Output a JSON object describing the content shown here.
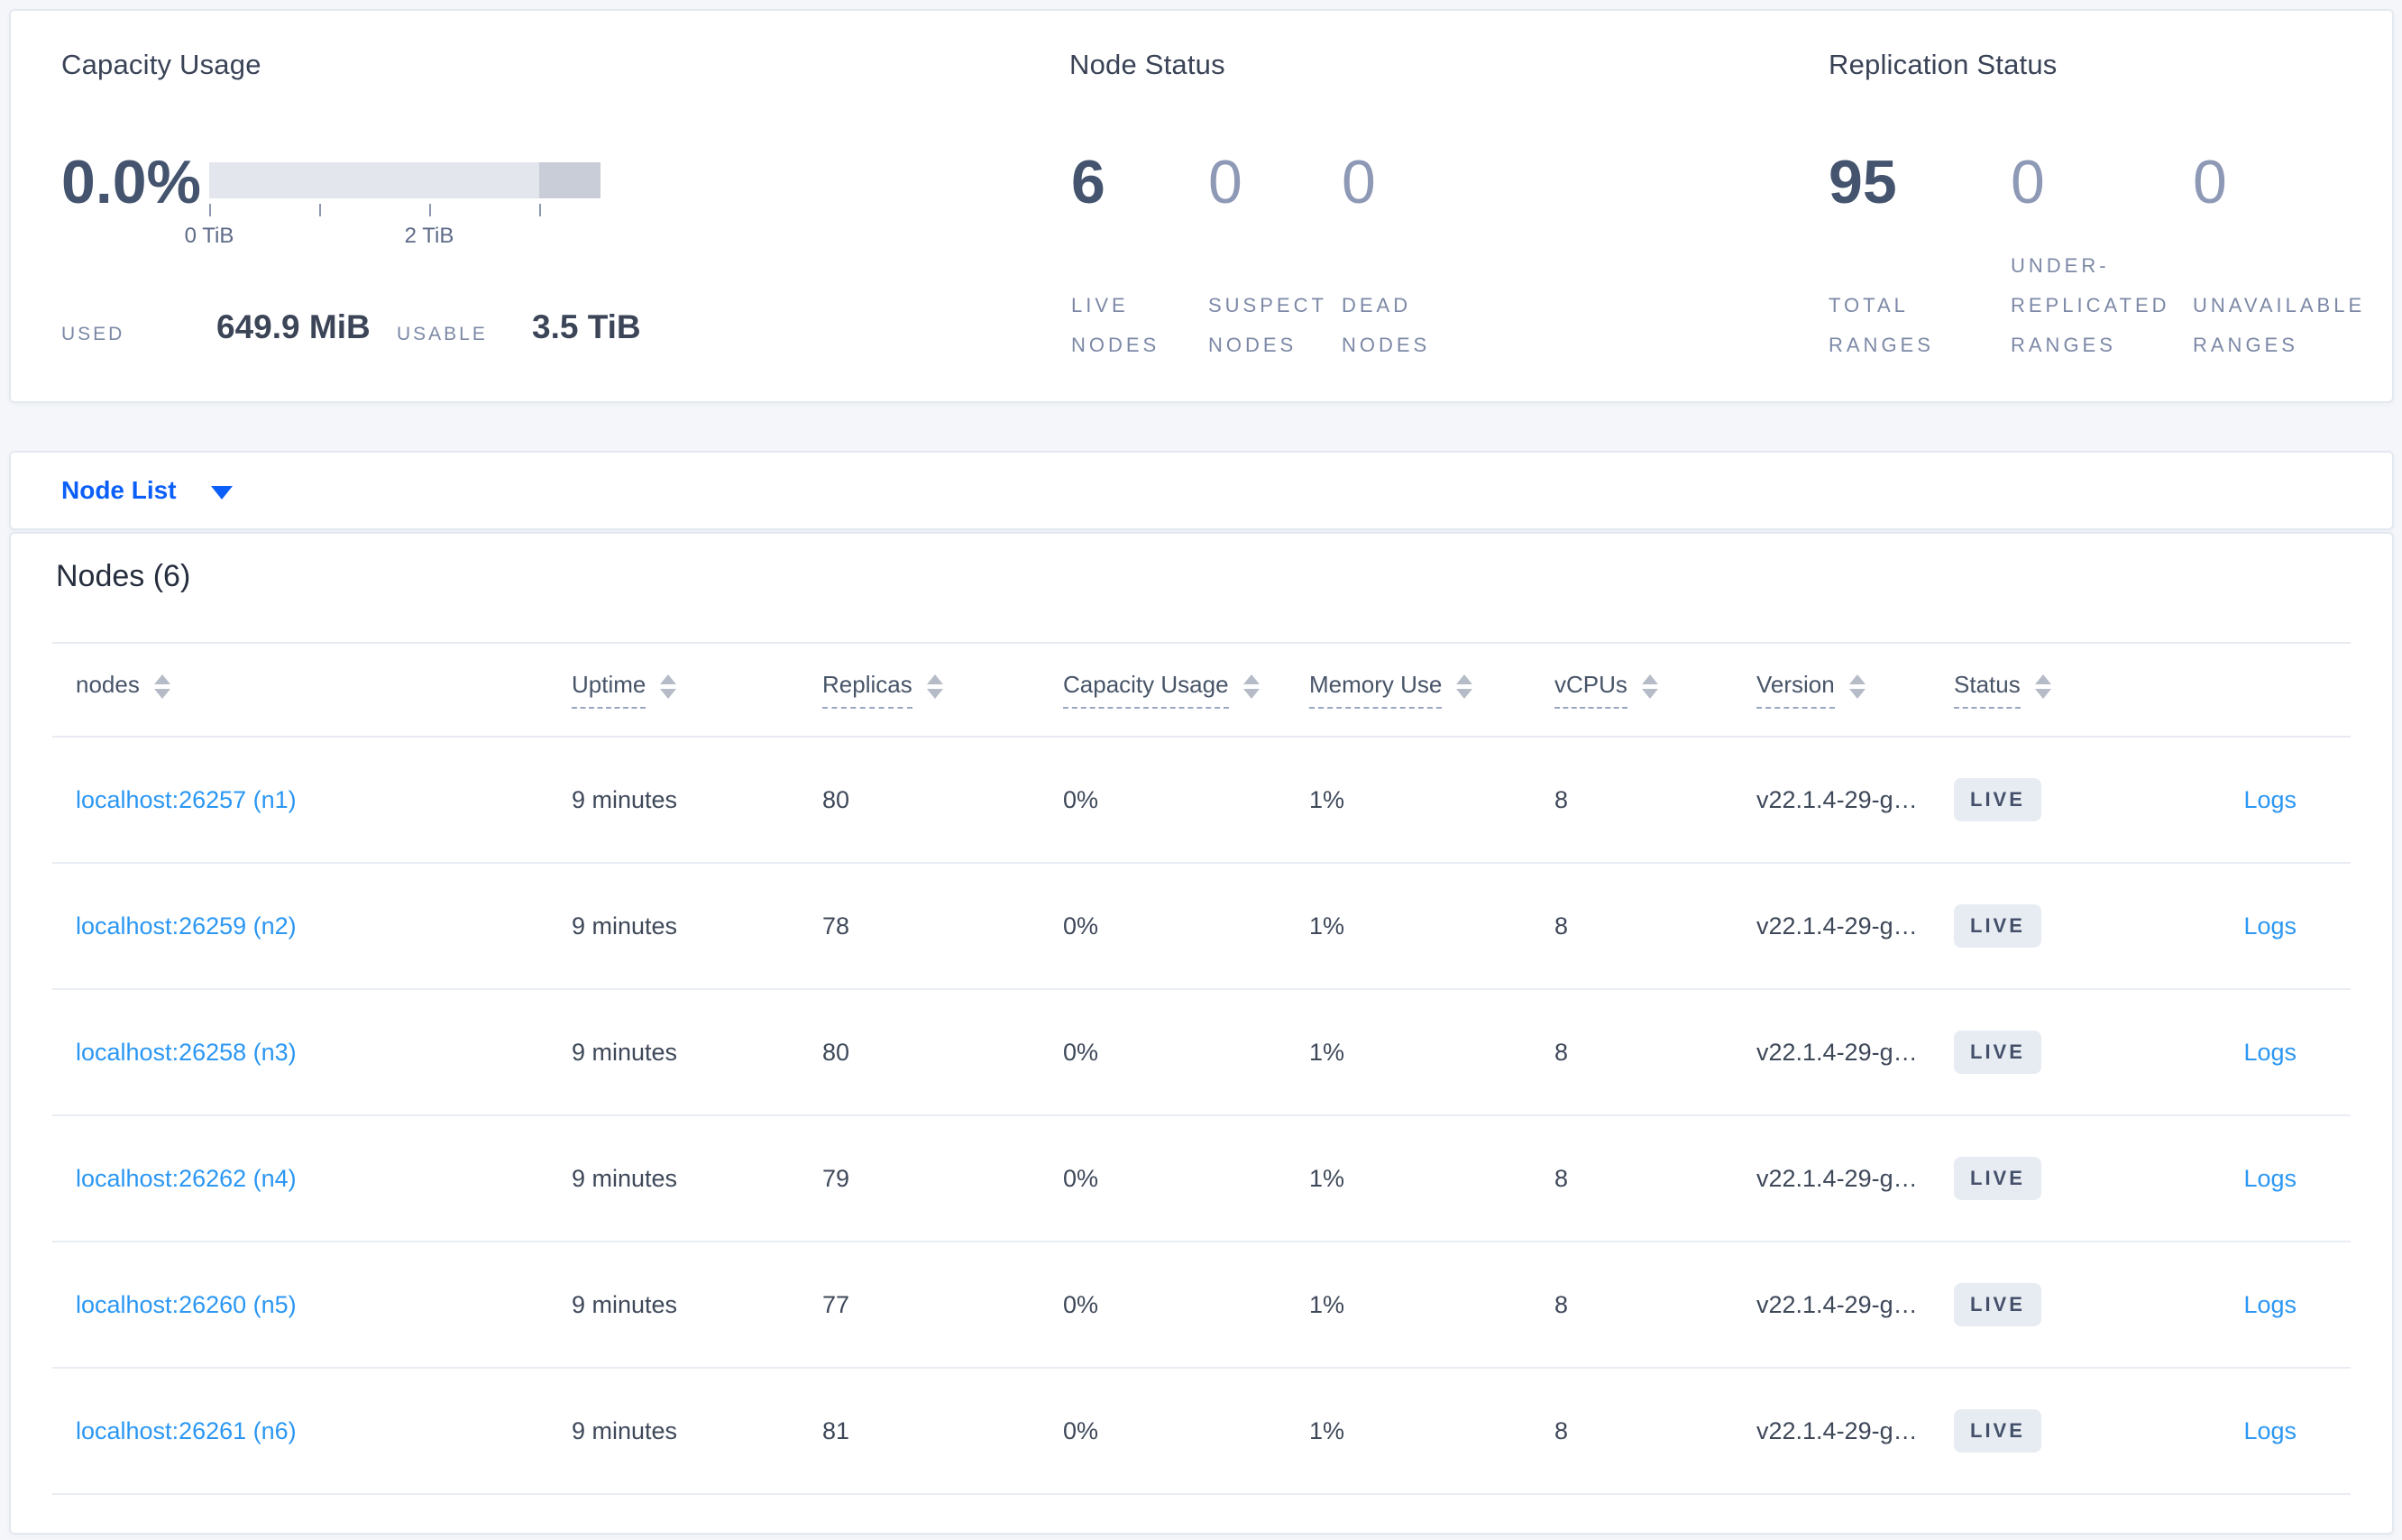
{
  "summary": {
    "capacity_usage": {
      "title": "Capacity Usage",
      "percent": "0.0%",
      "axis_ticks": [
        "0 TiB",
        "2 TiB"
      ],
      "used_label": "USED",
      "used_value": "649.9 MiB",
      "usable_label": "USABLE",
      "usable_value": "3.5 TiB"
    },
    "node_status": {
      "title": "Node Status",
      "stats": [
        {
          "value": "6",
          "label_lines": [
            "LIVE",
            "NODES"
          ]
        },
        {
          "value": "0",
          "label_lines": [
            "SUSPECT",
            "NODES"
          ]
        },
        {
          "value": "0",
          "label_lines": [
            "DEAD",
            "NODES"
          ]
        }
      ]
    },
    "replication_status": {
      "title": "Replication Status",
      "stats": [
        {
          "value": "95",
          "label_lines": [
            "TOTAL",
            "RANGES"
          ]
        },
        {
          "value": "0",
          "label_lines": [
            "UNDER-",
            "REPLICATED",
            "RANGES"
          ]
        },
        {
          "value": "0",
          "label_lines": [
            "UNAVAILABLE",
            "RANGES"
          ]
        }
      ]
    }
  },
  "node_list_bar": {
    "label": "Node List",
    "caret_icon": "chevron-down-icon"
  },
  "nodes_table": {
    "title": "Nodes (6)",
    "headers": {
      "nodes": "nodes",
      "uptime": "Uptime",
      "replicas": "Replicas",
      "capacity": "Capacity Usage",
      "memory": "Memory Use",
      "vcpus": "vCPUs",
      "version": "Version",
      "status": "Status"
    },
    "rows": [
      {
        "node": "localhost:26257 (n1)",
        "uptime": "9 minutes",
        "replicas": "80",
        "capacity": "0%",
        "memory": "1%",
        "vcpus": "8",
        "version": "v22.1.4-29-g…",
        "status": "LIVE",
        "logs": "Logs"
      },
      {
        "node": "localhost:26259 (n2)",
        "uptime": "9 minutes",
        "replicas": "78",
        "capacity": "0%",
        "memory": "1%",
        "vcpus": "8",
        "version": "v22.1.4-29-g…",
        "status": "LIVE",
        "logs": "Logs"
      },
      {
        "node": "localhost:26258 (n3)",
        "uptime": "9 minutes",
        "replicas": "80",
        "capacity": "0%",
        "memory": "1%",
        "vcpus": "8",
        "version": "v22.1.4-29-g…",
        "status": "LIVE",
        "logs": "Logs"
      },
      {
        "node": "localhost:26262 (n4)",
        "uptime": "9 minutes",
        "replicas": "79",
        "capacity": "0%",
        "memory": "1%",
        "vcpus": "8",
        "version": "v22.1.4-29-g…",
        "status": "LIVE",
        "logs": "Logs"
      },
      {
        "node": "localhost:26260 (n5)",
        "uptime": "9 minutes",
        "replicas": "77",
        "capacity": "0%",
        "memory": "1%",
        "vcpus": "8",
        "version": "v22.1.4-29-g…",
        "status": "LIVE",
        "logs": "Logs"
      },
      {
        "node": "localhost:26261 (n6)",
        "uptime": "9 minutes",
        "replicas": "81",
        "capacity": "0%",
        "memory": "1%",
        "vcpus": "8",
        "version": "v22.1.4-29-g…",
        "status": "LIVE",
        "logs": "Logs"
      }
    ]
  },
  "colors": {
    "page_background": "#f4f6fa",
    "accent_blue": "#0b5ff8",
    "link_blue": "#2b97f3",
    "big_number_dark": "#44536e",
    "big_number_light": "#8e99b6",
    "live_badge_bg": "#e7ebf2",
    "live_badge_text": "#44506a",
    "capacity_bar_light": "#e3e6ed",
    "capacity_bar_dark": "#c9cdd8"
  }
}
